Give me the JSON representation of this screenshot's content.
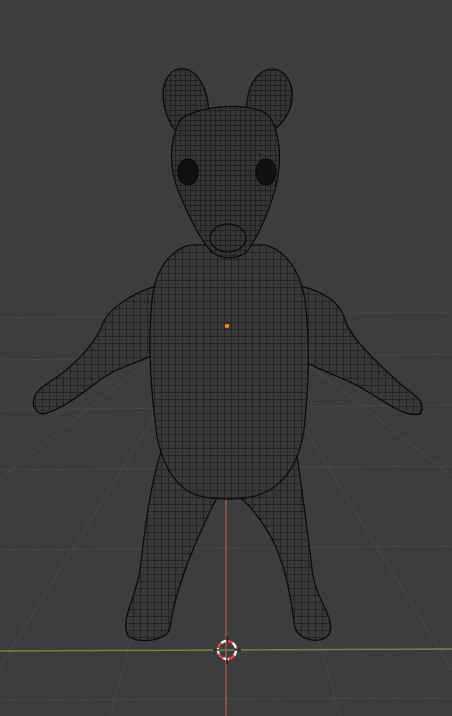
{
  "viewport": {
    "type": "3d-viewport",
    "shading": "wireframe",
    "object": "creature-mesh",
    "colors": {
      "background": "#3d3d3d",
      "grid": "#484848",
      "x_axis": "#a0524f",
      "y_axis": "#6a8a3a",
      "wire": "#141414",
      "mesh_fill": "#383838",
      "origin": "#e08a1e",
      "cursor_red": "#e34040",
      "cursor_white": "#f2f2f2"
    },
    "icons": [
      "object-origin-icon",
      "3d-cursor-icon"
    ]
  }
}
